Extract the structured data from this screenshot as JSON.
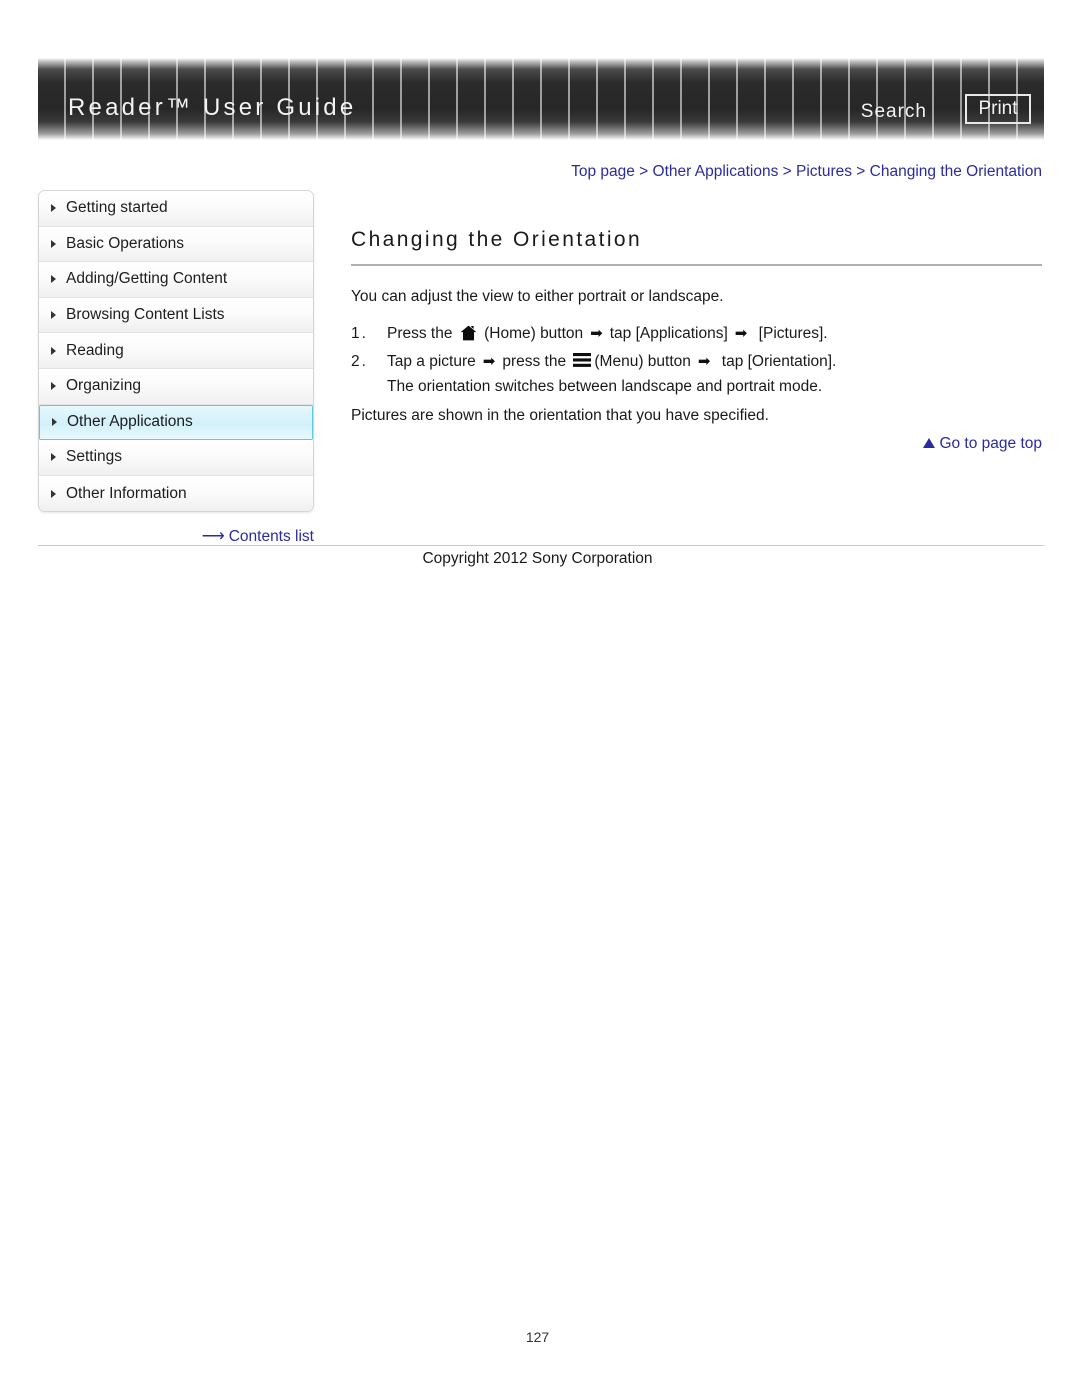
{
  "header": {
    "title": "Reader™ User Guide",
    "search_label": "Search",
    "print_label": "Print"
  },
  "breadcrumb": {
    "text": "Top page > Other Applications > Pictures > Changing the Orientation"
  },
  "sidebar": {
    "items": [
      {
        "label": "Getting started",
        "active": false
      },
      {
        "label": "Basic Operations",
        "active": false
      },
      {
        "label": "Adding/Getting Content",
        "active": false
      },
      {
        "label": "Browsing Content Lists",
        "active": false
      },
      {
        "label": "Reading",
        "active": false
      },
      {
        "label": "Organizing",
        "active": false
      },
      {
        "label": "Other Applications",
        "active": true
      },
      {
        "label": "Settings",
        "active": false
      },
      {
        "label": "Other Information",
        "active": false
      }
    ],
    "contents_list_label": "Contents list",
    "contents_list_arrow": "⟶",
    "active_highlight_color": "#d2f0fa",
    "active_border_color": "#5fc8e6",
    "link_color": "#2b2b9e"
  },
  "main": {
    "heading": "Changing the Orientation",
    "intro": "You can adjust the view to either portrait or landscape.",
    "steps": [
      {
        "number": "1.",
        "parts": [
          {
            "type": "text",
            "value": "Press the "
          },
          {
            "type": "icon",
            "value": "home-icon"
          },
          {
            "type": "text",
            "value": " (Home) button"
          },
          {
            "type": "arrow",
            "value": "➡"
          },
          {
            "type": "text",
            "value": "tap [Applications]"
          },
          {
            "type": "arrow",
            "value": "➡"
          },
          {
            "type": "text",
            "value": " [Pictures]."
          }
        ],
        "note": null
      },
      {
        "number": "2.",
        "parts": [
          {
            "type": "text",
            "value": "Tap a picture"
          },
          {
            "type": "arrow",
            "value": "➡"
          },
          {
            "type": "text",
            "value": "press the "
          },
          {
            "type": "icon",
            "value": "menu-icon"
          },
          {
            "type": "text",
            "value": "(Menu) button"
          },
          {
            "type": "arrow",
            "value": "➡"
          },
          {
            "type": "text",
            "value": " tap [Orientation]."
          }
        ],
        "note": "The orientation switches between landscape and portrait mode."
      }
    ],
    "closing": "Pictures are shown in the orientation that you have specified.",
    "goto_top_label": "Go to page top"
  },
  "footer": {
    "copyright": "Copyright 2012 Sony Corporation",
    "page_number": "127"
  }
}
